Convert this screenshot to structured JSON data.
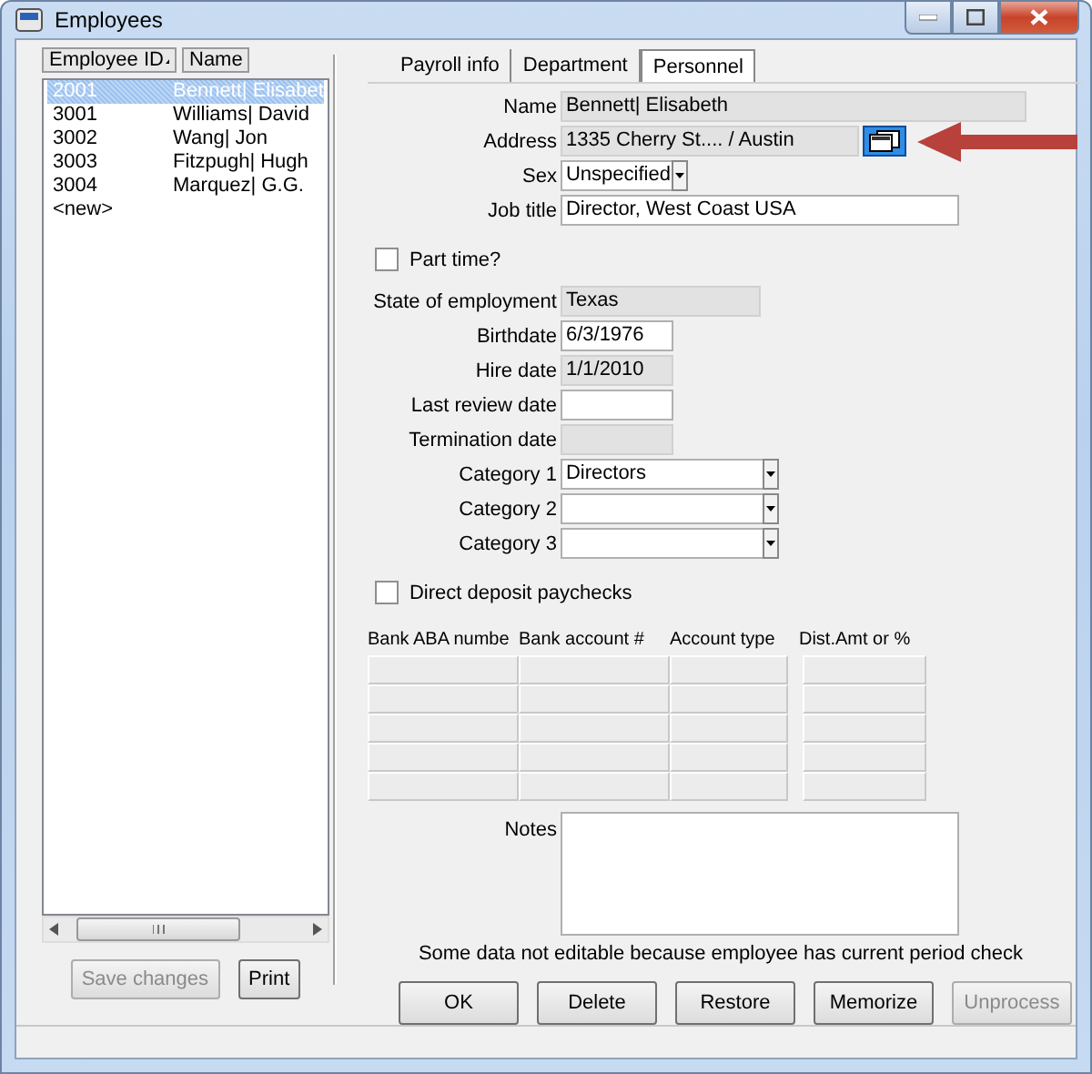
{
  "window": {
    "title": "Employees"
  },
  "employee_list": {
    "columns": [
      {
        "label": "Employee ID",
        "sorted": true
      },
      {
        "label": "Name",
        "sorted": false
      }
    ],
    "rows": [
      {
        "id": "2001",
        "name": "Bennett| Elisabet",
        "selected": true
      },
      {
        "id": "3001",
        "name": "Williams| David",
        "selected": false
      },
      {
        "id": "3002",
        "name": "Wang| Jon",
        "selected": false
      },
      {
        "id": "3003",
        "name": "Fitzpugh| Hugh",
        "selected": false
      },
      {
        "id": "3004",
        "name": "Marquez| G.G.",
        "selected": false
      },
      {
        "id": "<new>",
        "selected": false
      }
    ]
  },
  "list_buttons": [
    {
      "label": "Save changes",
      "disabled": true
    },
    {
      "label": "Print",
      "disabled": false
    }
  ],
  "tabs": [
    {
      "label": "Payroll info",
      "selected": false
    },
    {
      "label": "Department",
      "selected": false
    },
    {
      "label": "Personnel",
      "selected": true
    }
  ],
  "form": [
    {
      "kind": "text",
      "label": "Name",
      "value": "Bennett| Elisabeth",
      "editable": false
    },
    {
      "kind": "address",
      "label": "Address",
      "value": "1335 Cherry St.... / Austin",
      "editable": false
    },
    {
      "kind": "dropdown",
      "label": "Sex",
      "value": "Unspecified",
      "editable": true
    },
    {
      "kind": "text",
      "label": "Job title",
      "value": "Director, West Coast USA",
      "editable": true
    },
    {
      "kind": "checkbox",
      "label": "Part time?",
      "checked": false
    },
    {
      "kind": "text",
      "label": "State of employment",
      "value": "Texas",
      "editable": false
    },
    {
      "kind": "text",
      "label": "Birthdate",
      "value": "6/3/1976",
      "editable": true
    },
    {
      "kind": "text",
      "label": "Hire date",
      "value": "1/1/2010",
      "editable": false
    },
    {
      "kind": "text",
      "label": "Last review date",
      "editable": true
    },
    {
      "kind": "text",
      "label": "Termination date",
      "editable": false
    },
    {
      "kind": "dropdown",
      "label": "Category 1",
      "value": "Directors",
      "editable": true
    },
    {
      "kind": "dropdown",
      "label": "Category 2",
      "editable": true
    },
    {
      "kind": "dropdown",
      "label": "Category 3",
      "editable": true
    },
    {
      "kind": "checkbox",
      "label": "Direct deposit paychecks",
      "checked": false
    }
  ],
  "bank_grid": {
    "columns": [
      "Bank ABA numbe",
      "Bank account #",
      "Account type",
      "Dist.Amt or %"
    ],
    "rows": [
      {
        "editable": false
      },
      {
        "editable": false
      },
      {
        "editable": false
      },
      {
        "editable": false
      },
      {
        "editable": false
      }
    ]
  },
  "notes": {
    "label": "Notes"
  },
  "message": "Some data not editable because employee has current period check",
  "buttons": [
    {
      "label": "OK",
      "disabled": false
    },
    {
      "label": "Delete",
      "disabled": false
    },
    {
      "label": "Restore",
      "disabled": false
    },
    {
      "label": "Memorize",
      "disabled": false
    },
    {
      "label": "Unprocess",
      "disabled": true
    }
  ]
}
